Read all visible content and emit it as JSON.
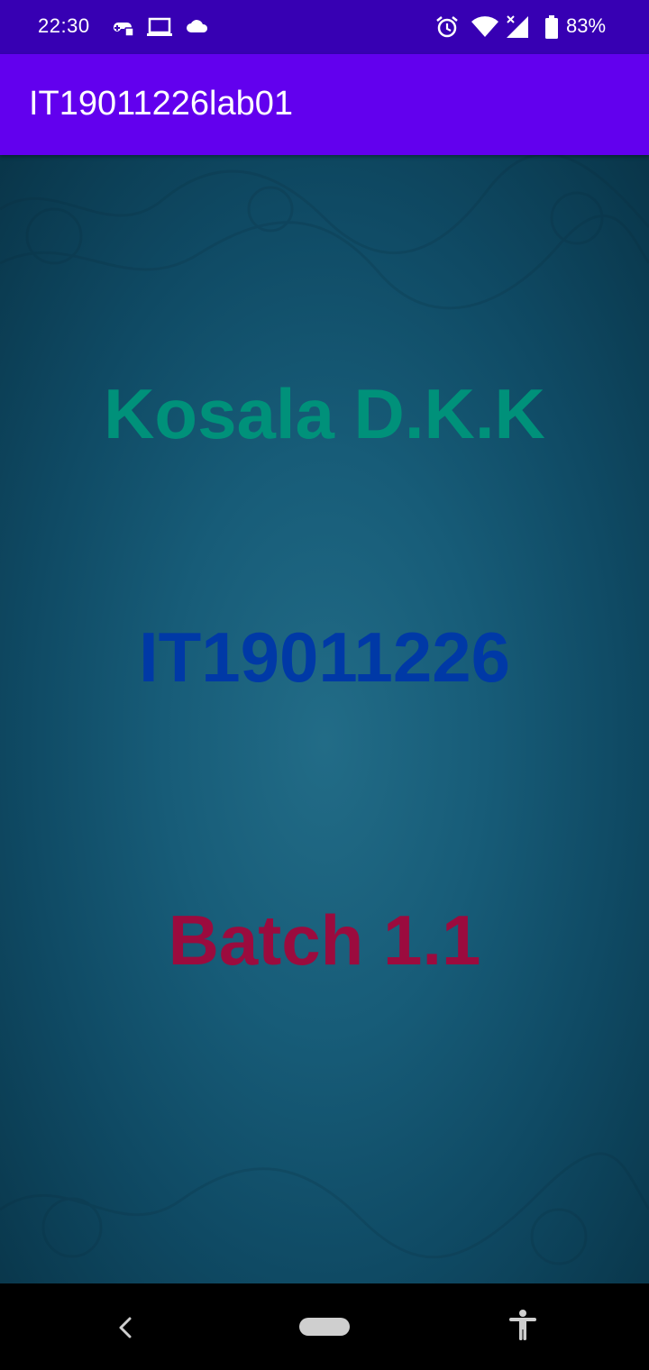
{
  "status_bar": {
    "time": "22:30",
    "battery_percent": "83%",
    "icons": [
      "game-controller-icon",
      "laptop-icon",
      "cloud-icon",
      "alarm-icon",
      "wifi-icon",
      "signal-icon",
      "battery-icon"
    ]
  },
  "app_bar": {
    "title": "IT19011226lab01"
  },
  "main": {
    "name": "Kosala D.K.K",
    "student_id": "IT19011226",
    "batch": "Batch 1.1"
  },
  "nav_bar": {
    "icons": [
      "back-icon",
      "home-pill",
      "accessibility-icon"
    ]
  },
  "colors": {
    "status_bar": "#3700b3",
    "app_bar": "#6200ee",
    "name_text": "#00917a",
    "id_text": "#0039a6",
    "batch_text": "#9b0b3e",
    "background": "#175c78"
  }
}
